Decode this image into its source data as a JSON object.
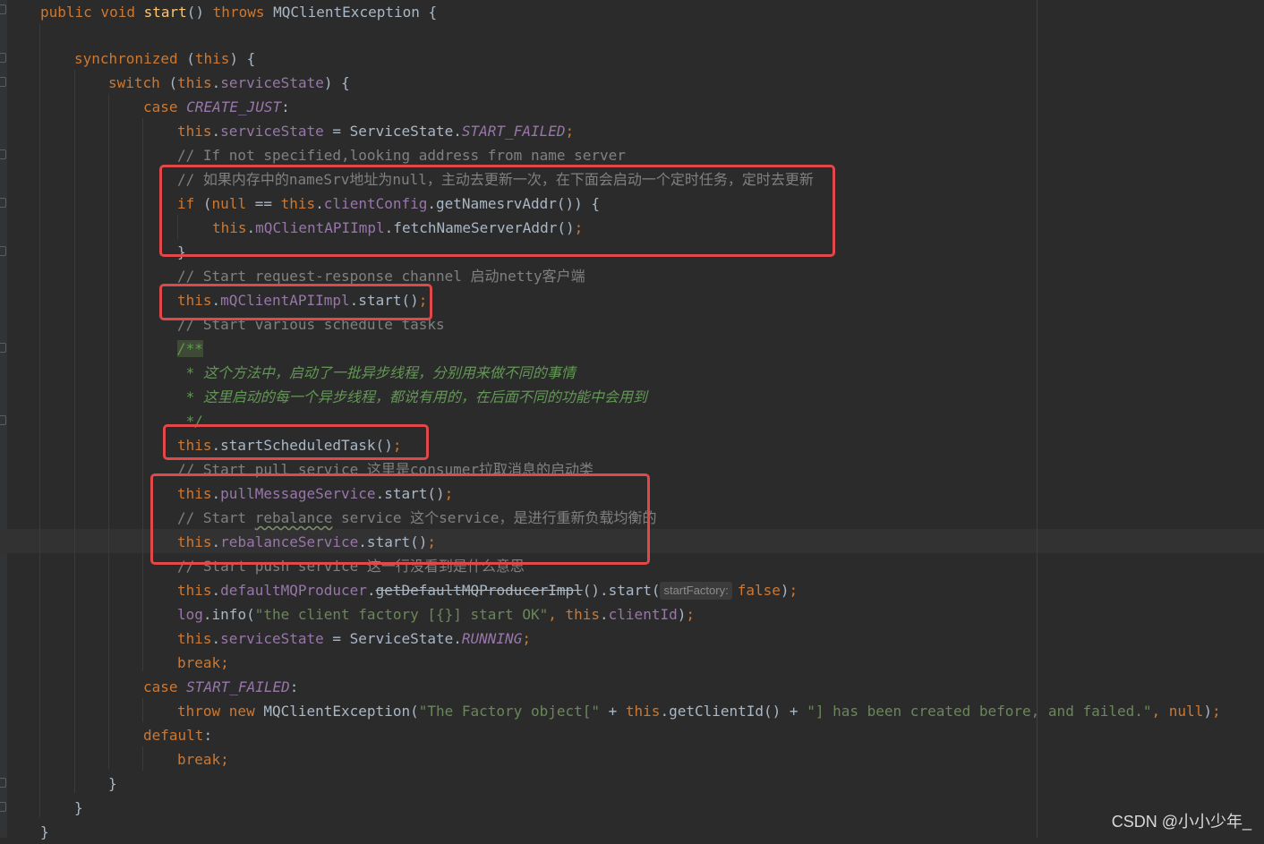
{
  "editor": {
    "lines": [
      {
        "id": "l1",
        "tokens": [
          [
            "kw",
            "public void "
          ],
          [
            "fn",
            "start"
          ],
          [
            "",
            "() "
          ],
          [
            "kw",
            "throws "
          ],
          [
            "",
            "MQClientException {"
          ]
        ]
      },
      {
        "id": "l3",
        "tokens": [
          [
            "kw",
            "synchronized "
          ],
          [
            "",
            "("
          ],
          [
            "kw",
            "this"
          ],
          [
            "",
            ") {"
          ]
        ]
      },
      {
        "id": "l4",
        "tokens": [
          [
            "kw",
            "switch "
          ],
          [
            "",
            "("
          ],
          [
            "kw",
            "this"
          ],
          [
            "",
            "."
          ],
          [
            "fld",
            "serviceState"
          ],
          [
            "",
            ") {"
          ]
        ]
      },
      {
        "id": "l5",
        "tokens": [
          [
            "kw",
            "case "
          ],
          [
            "cst",
            "CREATE_JUST"
          ],
          [
            "",
            ":"
          ]
        ]
      },
      {
        "id": "l6",
        "tokens": [
          [
            "kw",
            "this"
          ],
          [
            "",
            "."
          ],
          [
            "fld",
            "serviceState"
          ],
          [
            "",
            " = ServiceState."
          ],
          [
            "cst",
            "START_FAILED"
          ],
          [
            "kw",
            ";"
          ]
        ]
      },
      {
        "id": "l7",
        "tokens": [
          [
            "cmt",
            "// If not specified,looking address from name server"
          ]
        ]
      },
      {
        "id": "l8",
        "tokens": [
          [
            "cmt",
            "// 如果内存中的nameSrv地址为null，主动去更新一次，在下面会启动一个定时任务，定时去更新"
          ]
        ]
      },
      {
        "id": "l9",
        "tokens": [
          [
            "kw",
            "if "
          ],
          [
            "",
            "("
          ],
          [
            "kw",
            "null "
          ],
          [
            "",
            "== "
          ],
          [
            "kw",
            "this"
          ],
          [
            "",
            "."
          ],
          [
            "fld",
            "clientConfig"
          ],
          [
            "",
            ".getNamesrvAddr()) {"
          ]
        ]
      },
      {
        "id": "l10",
        "tokens": [
          [
            "kw",
            "this"
          ],
          [
            "",
            "."
          ],
          [
            "fld",
            "mQClientAPIImpl"
          ],
          [
            "",
            ".fetchNameServerAddr()"
          ],
          [
            "kw",
            ";"
          ]
        ]
      },
      {
        "id": "l11",
        "tokens": [
          [
            "",
            "}"
          ]
        ]
      },
      {
        "id": "l12",
        "tokens": [
          [
            "cmt",
            "// Start request-response channel 启动netty客户端"
          ]
        ]
      },
      {
        "id": "l13",
        "tokens": [
          [
            "kw",
            "this"
          ],
          [
            "",
            "."
          ],
          [
            "fld",
            "mQClientAPIImpl"
          ],
          [
            "",
            ".start()"
          ],
          [
            "kw",
            ";"
          ]
        ]
      },
      {
        "id": "l14",
        "tokens": [
          [
            "cmt",
            "// Start various schedule tasks"
          ]
        ]
      },
      {
        "id": "l15",
        "tokens": [
          [
            "doc docbg",
            "/**"
          ]
        ]
      },
      {
        "id": "l16",
        "tokens": [
          [
            "doc",
            " * 这个方法中，启动了一批异步线程，分别用来做不同的事情"
          ]
        ]
      },
      {
        "id": "l17",
        "tokens": [
          [
            "doc",
            " * 这里启动的每一个异步线程，都说有用的，在后面不同的功能中会用到"
          ]
        ]
      },
      {
        "id": "l18",
        "tokens": [
          [
            "doc",
            " */"
          ]
        ]
      },
      {
        "id": "l19",
        "tokens": [
          [
            "kw",
            "this"
          ],
          [
            "",
            ".startScheduledTask()"
          ],
          [
            "kw",
            ";"
          ]
        ]
      },
      {
        "id": "l20",
        "tokens": [
          [
            "cmt",
            "// Start pull service 这里是consumer拉取消息的启动类"
          ]
        ]
      },
      {
        "id": "l21",
        "tokens": [
          [
            "kw",
            "this"
          ],
          [
            "",
            "."
          ],
          [
            "fld",
            "pullMessageService"
          ],
          [
            "",
            ".start()"
          ],
          [
            "kw",
            ";"
          ]
        ]
      },
      {
        "id": "l22",
        "tokens": [
          [
            "cmt",
            "// Start "
          ],
          [
            "cmt squig",
            "rebalance"
          ],
          [
            "cmt",
            " service 这个service，是进行重新负载均衡的"
          ]
        ]
      },
      {
        "id": "l23",
        "tokens": [
          [
            "kw",
            "this"
          ],
          [
            "",
            "."
          ],
          [
            "fld",
            "rebalanceService"
          ],
          [
            "",
            ".start()"
          ],
          [
            "kw",
            ";"
          ]
        ]
      },
      {
        "id": "l24",
        "tokens": [
          [
            "cmt",
            "// Start push service 这一行没看到是什么意思"
          ]
        ]
      },
      {
        "id": "l25",
        "tokens": [
          [
            "kw",
            "this"
          ],
          [
            "",
            "."
          ],
          [
            "fld",
            "defaultMQProducer"
          ],
          [
            "",
            "."
          ],
          [
            "strike",
            "getDefaultMQProducerImpl"
          ],
          [
            "",
            "().start("
          ],
          [
            "hint",
            "startFactory:"
          ],
          [
            "kw",
            "false"
          ],
          [
            "",
            ")"
          ],
          [
            "kw",
            ";"
          ]
        ]
      },
      {
        "id": "l26",
        "tokens": [
          [
            "fld",
            "log"
          ],
          [
            "",
            ".info("
          ],
          [
            "str",
            "\"the client factory [{}] start OK\""
          ],
          [
            "kw",
            ", this"
          ],
          [
            "",
            "."
          ],
          [
            "fld",
            "clientId"
          ],
          [
            "",
            ")"
          ],
          [
            "kw",
            ";"
          ]
        ]
      },
      {
        "id": "l27",
        "tokens": [
          [
            "kw",
            "this"
          ],
          [
            "",
            "."
          ],
          [
            "fld",
            "serviceState"
          ],
          [
            "",
            " = ServiceState."
          ],
          [
            "cst",
            "RUNNING"
          ],
          [
            "kw",
            ";"
          ]
        ]
      },
      {
        "id": "l28",
        "tokens": [
          [
            "kw",
            "break;"
          ]
        ]
      },
      {
        "id": "l29",
        "tokens": [
          [
            "kw",
            "case "
          ],
          [
            "cst",
            "START_FAILED"
          ],
          [
            "",
            ":"
          ]
        ]
      },
      {
        "id": "l30",
        "tokens": [
          [
            "kw",
            "throw new "
          ],
          [
            "",
            "MQClientException("
          ],
          [
            "str",
            "\"The Factory object[\" "
          ],
          [
            "",
            "+ "
          ],
          [
            "kw",
            "this"
          ],
          [
            "",
            ".getClientId() + "
          ],
          [
            "str",
            "\"] has been created before, and failed.\""
          ],
          [
            "kw",
            ", null"
          ],
          [
            "",
            ")"
          ],
          [
            "kw",
            ";"
          ]
        ]
      },
      {
        "id": "l31",
        "tokens": [
          [
            "kw",
            "default"
          ],
          [
            "",
            ":"
          ]
        ]
      },
      {
        "id": "l32",
        "tokens": [
          [
            "kw",
            "break;"
          ]
        ]
      },
      {
        "id": "l33",
        "tokens": [
          [
            "",
            "}"
          ]
        ]
      },
      {
        "id": "l34",
        "tokens": [
          [
            "",
            "}"
          ]
        ]
      },
      {
        "id": "l35",
        "tokens": [
          [
            "",
            "}"
          ]
        ]
      }
    ]
  },
  "watermark": "CSDN @小小少年_",
  "colors": {
    "background": "#2b2b2b",
    "keyword": "#cc7832",
    "field": "#9876aa",
    "method": "#ffc66d",
    "string": "#6a8759",
    "comment": "#808080",
    "doc_comment": "#629755",
    "highlight_box": "#e0484a"
  }
}
